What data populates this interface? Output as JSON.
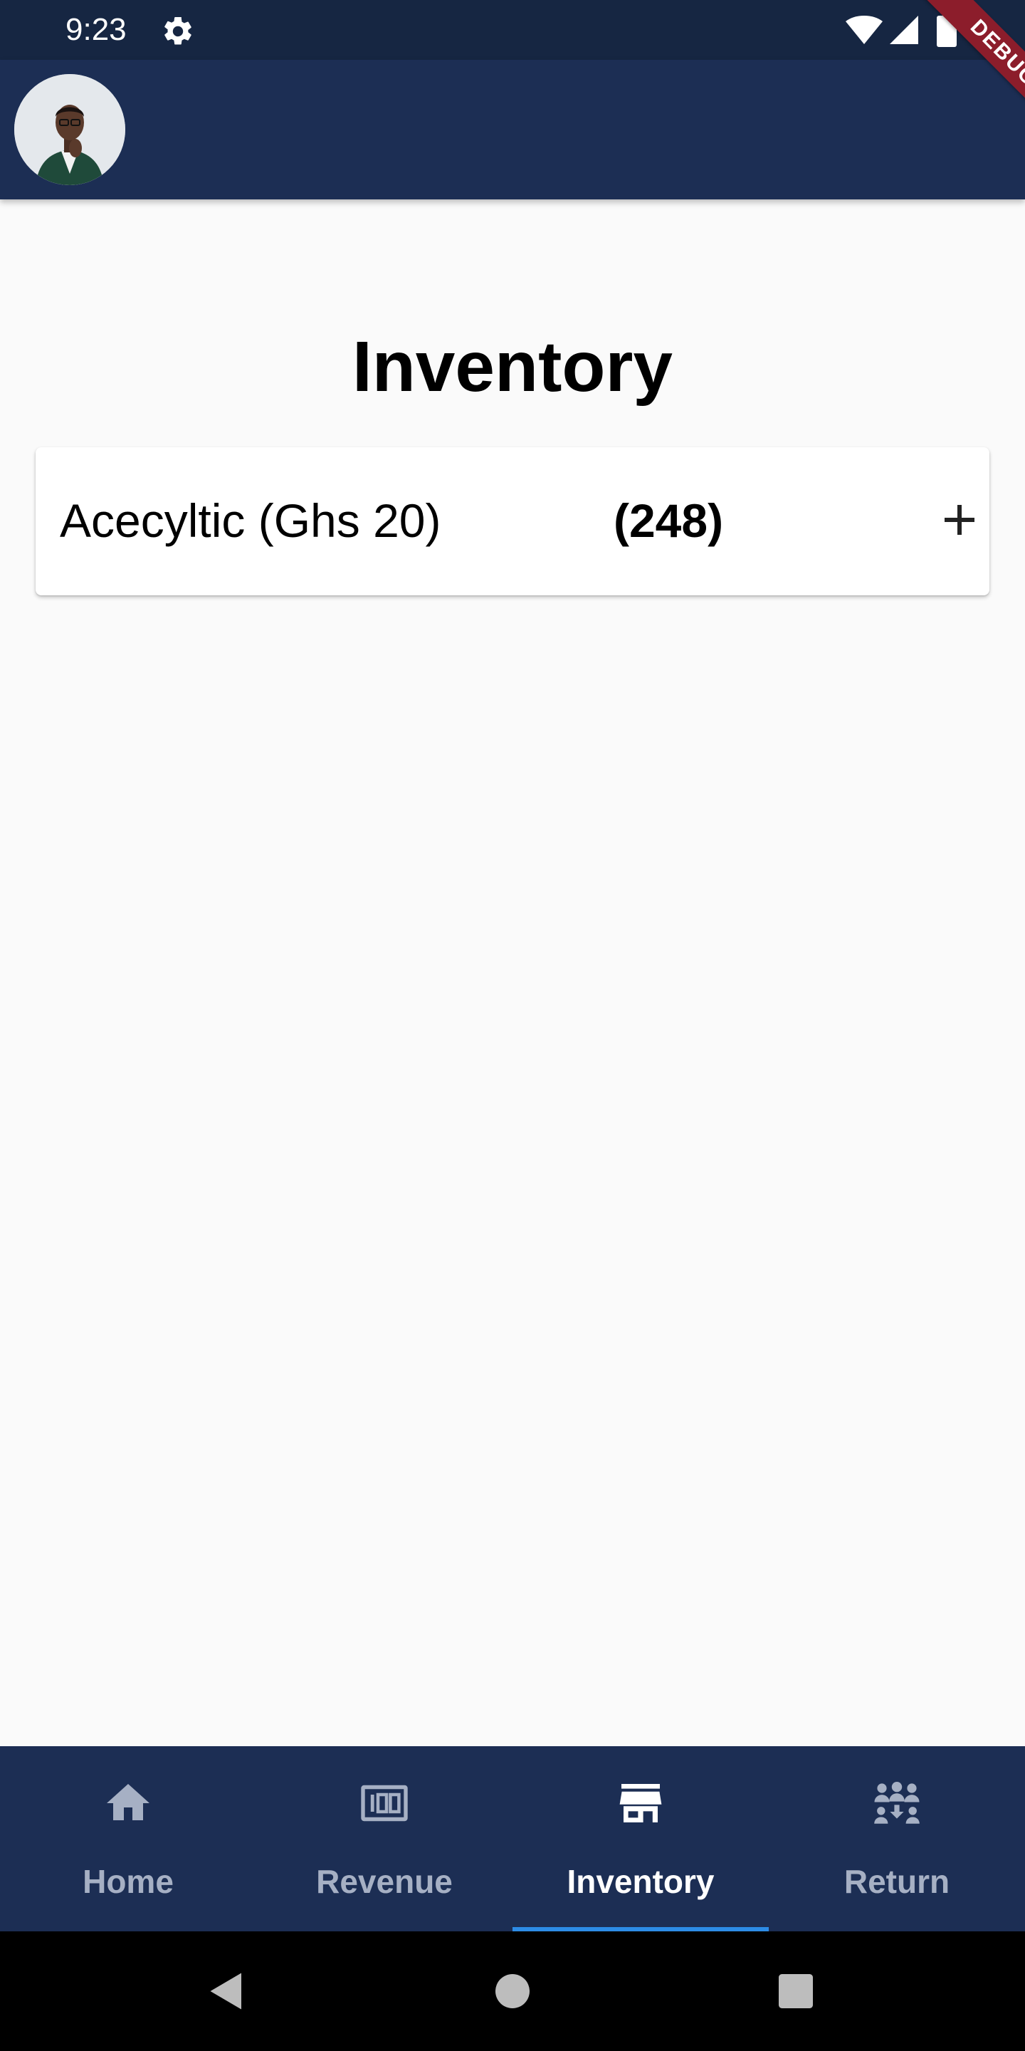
{
  "status_bar": {
    "time": "9:23",
    "icons": [
      "gear-icon",
      "wifi-icon",
      "signal-icon",
      "battery-icon"
    ]
  },
  "debug_banner": {
    "label": "DEBUG"
  },
  "page": {
    "title": "Inventory"
  },
  "inventory": {
    "items": [
      {
        "name": "Acecyltic (Ghs 20)",
        "count": "(248)",
        "action_icon": "plus-icon"
      }
    ]
  },
  "bottom_nav": {
    "items": [
      {
        "label": "Home",
        "icon": "home-icon"
      },
      {
        "label": "Revenue",
        "icon": "banknote-icon"
      },
      {
        "label": "Inventory",
        "icon": "store-icon"
      },
      {
        "label": "Return",
        "icon": "group-icon"
      }
    ],
    "active_index": 2
  },
  "system_nav": {
    "buttons": [
      "back-icon",
      "home-circle-icon",
      "recents-icon"
    ]
  },
  "colors": {
    "status_bar": "#162642",
    "app_bar": "#1c2e54",
    "nav_inactive": "#a6b0c4",
    "nav_active": "#ffffff",
    "nav_indicator": "#2d8ce6",
    "debug_ribbon": "#8c1d2b",
    "page_bg": "#fafafa"
  }
}
